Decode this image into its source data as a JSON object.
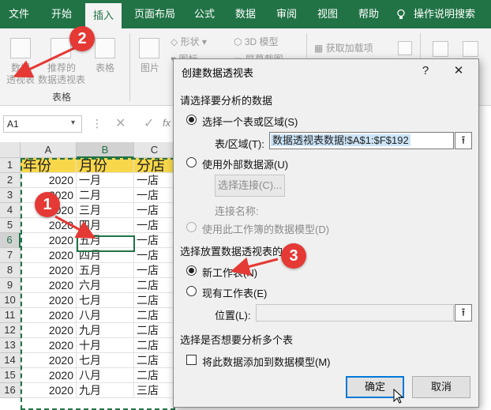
{
  "ribbon_tabs": [
    "文件",
    "开始",
    "插入",
    "页面布局",
    "公式",
    "数据",
    "审阅",
    "视图",
    "帮助",
    "操作说明搜索"
  ],
  "ribbon": {
    "pivot_label_1": "数据",
    "pivot_label_2": "透视表",
    "recommended_label_1": "推荐的",
    "recommended_label_2": "数据透视表",
    "table_label": "表格",
    "group_label": "表格",
    "pictures_label": "图片",
    "shapes_label": "形状",
    "model3d_label": "3D 模型",
    "icons_label": "图标",
    "screenshot_label": "屏幕截图",
    "addins_label": "获取加载项"
  },
  "namebox": "A1",
  "fx_label": "fx",
  "columns": [
    "A",
    "B",
    "C"
  ],
  "rows": [
    {
      "n": "1",
      "a": "年份",
      "b": "月份",
      "c": "分店"
    },
    {
      "n": "2",
      "a": "2020",
      "b": "一月",
      "c": "一店"
    },
    {
      "n": "3",
      "a": "2020",
      "b": "二月",
      "c": "一店"
    },
    {
      "n": "4",
      "a": "2020",
      "b": "三月",
      "c": "一店"
    },
    {
      "n": "5",
      "a": "2020",
      "b": "四月",
      "c": "一店"
    },
    {
      "n": "6",
      "a": "2020",
      "b": "五月",
      "c": "一店"
    },
    {
      "n": "7",
      "a": "2020",
      "b": "四月",
      "c": "一店"
    },
    {
      "n": "8",
      "a": "2020",
      "b": "五月",
      "c": "一店"
    },
    {
      "n": "9",
      "a": "2020",
      "b": "六月",
      "c": "二店"
    },
    {
      "n": "10",
      "a": "2020",
      "b": "七月",
      "c": "二店"
    },
    {
      "n": "11",
      "a": "2020",
      "b": "八月",
      "c": "二店"
    },
    {
      "n": "12",
      "a": "2020",
      "b": "九月",
      "c": "二店"
    },
    {
      "n": "13",
      "a": "2020",
      "b": "十月",
      "c": "二店"
    },
    {
      "n": "14",
      "a": "2020",
      "b": "七月",
      "c": "二店"
    },
    {
      "n": "15",
      "a": "2020",
      "b": "八月",
      "c": "二店"
    },
    {
      "n": "16",
      "a": "2020",
      "b": "九月",
      "c": "三店"
    }
  ],
  "dialog": {
    "title": "创建数据透视表",
    "help": "?",
    "close": "✕",
    "section_source": "请选择要分析的数据",
    "opt_range": "选择一个表或区域(S)",
    "range_label": "表/区域(T):",
    "range_value": "数据透视表数据!$A$1:$F$192",
    "opt_external": "使用外部数据源(U)",
    "choose_conn": "选择连接(C)...",
    "conn_name": "连接名称:",
    "opt_model": "使用此工作簿的数据模型(D)",
    "section_location": "选择放置数据透视表的位置",
    "opt_new_sheet": "新工作表(N)",
    "opt_existing_sheet": "现有工作表(E)",
    "location_label": "位置(L):",
    "section_multi": "选择是否想要分析多个表",
    "add_to_model": "将此数据添加到数据模型(M)",
    "ok": "确定",
    "cancel": "取消"
  },
  "callouts": [
    "1",
    "2",
    "3"
  ],
  "colors": {
    "ribbon_green": "#217346",
    "header_fill": "#f8d74a",
    "callout_red": "#e53935",
    "default_button_border": "#0078d7"
  }
}
